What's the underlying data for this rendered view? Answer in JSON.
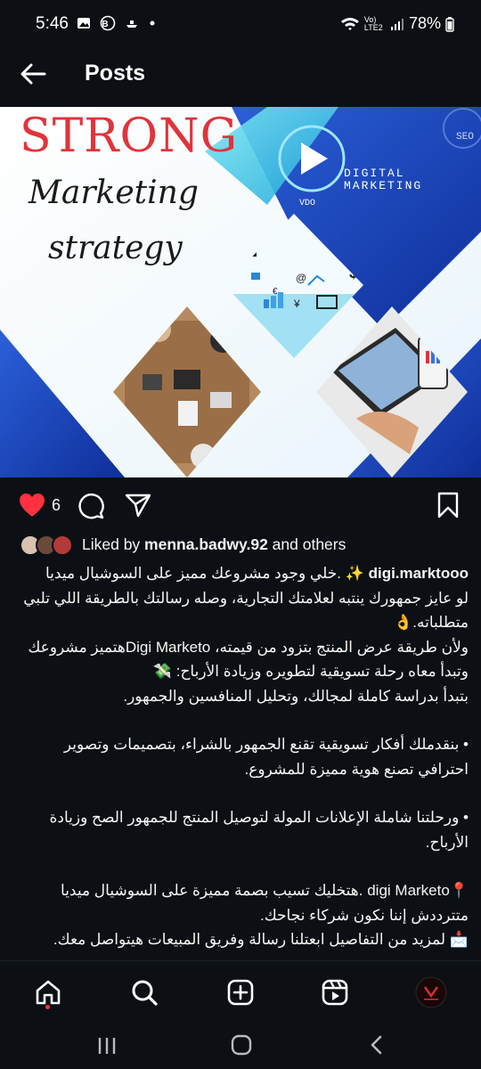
{
  "status_bar": {
    "time": "5:46",
    "left_icons": [
      "image-icon",
      "b-icon",
      "boat-icon",
      "dot"
    ],
    "network": "Vo) LTE2",
    "battery": "78%"
  },
  "header": {
    "title": "Posts"
  },
  "post_image": {
    "headline_strong": "STRONG",
    "headline_marketing": "Marketing",
    "headline_strategy": "strategy",
    "vdo_label": "VDO",
    "digital_marketing": "DIGITAL MARKETING",
    "seo_label": "SEO"
  },
  "actions": {
    "like_count": "6"
  },
  "liked_by": {
    "prefix": "Liked by ",
    "user": "menna.badwy.92",
    "suffix": " and others"
  },
  "caption": {
    "username": "digi.marktooo",
    "line1": " ✨ .خلي وجود مشروعك مميز على السوشيال ميديا",
    "line2": "لو عايز جمهورك ينتبه لعلامتك التجارية، وصله رسالتك بالطريقة اللي تلبي متطلباته.👌",
    "line3": "ولأن طريقة عرض المنتج بتزود من قيمته، Digi Marketoهتميز مشروعك وتبدأ معاه رحلة تسويقية لتطويره وزيادة الأرباح: 💸",
    "line4": "بتبدأ بدراسة كاملة لمجالك، وتحليل المنافسين والجمهور.",
    "bullet1": "• بنقدملك أفكار تسويقية تقنع الجمهور بالشراء، بتصميمات وتصوير احترافي تصنع هوية مميزة للمشروع.",
    "bullet2": "• ورحلتنا شاملة الإعلانات المولة لتوصيل المنتج للجمهور الصح وزيادة الأرباح.",
    "line5": "📍digi Marketo .هتخليك تسيب بصمة مميزة على السوشيال ميديا",
    "line6": "متترددش إننا نكون شركاء نجاحك.",
    "line7": "📩 لمزيد من التفاصيل ابعتلنا رسالة وفريق المبيعات هيتواصل معك."
  },
  "bottom_nav": [
    "home-icon",
    "search-icon",
    "create-icon",
    "reels-icon",
    "profile-avatar"
  ],
  "colors": {
    "background": "#0c1014",
    "like_red": "#ff3040",
    "brand_blue": "#1a49c4",
    "strong_red": "#e0343a"
  }
}
